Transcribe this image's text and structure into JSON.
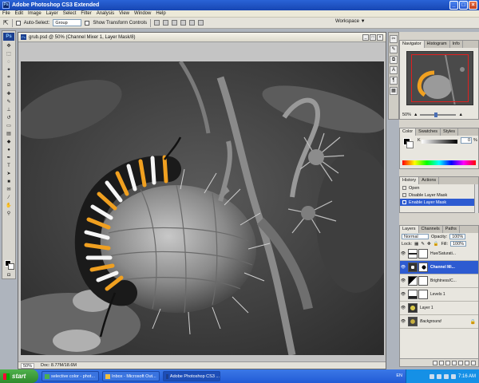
{
  "app": {
    "title": "Adobe Photoshop CS3 Extended",
    "ps_badge": "Ps",
    "window_controls": [
      "_",
      "□",
      "×"
    ]
  },
  "menu": [
    "File",
    "Edit",
    "Image",
    "Layer",
    "Select",
    "Filter",
    "Analysis",
    "View",
    "Window",
    "Help"
  ],
  "options": {
    "auto_select_label": "Auto-Select:",
    "auto_select_value": "Group",
    "show_transform_label": "Show Transform Controls",
    "workspace_label": "Workspace ▼"
  },
  "document": {
    "title": "grub.psd @ 50% (Channel Mixer 1, Layer Mask/8)",
    "zoom": "50%",
    "doc_info": "Doc: 8.77M/18.6M",
    "controls": [
      "_",
      "□",
      "×"
    ]
  },
  "navigator": {
    "tabs": [
      "Navigator",
      "Histogram",
      "Info"
    ],
    "zoom": "50%"
  },
  "color_panel": {
    "tabs": [
      "Color",
      "Swatches",
      "Styles"
    ],
    "k_label": "K",
    "k_value": "0",
    "k_unit": "%"
  },
  "history": {
    "tabs": [
      "History",
      "Actions"
    ],
    "items": [
      "Open",
      "Disable Layer Mask",
      "Enable Layer Mask"
    ],
    "selected_index": 2
  },
  "layers_panel": {
    "tabs": [
      "Layers",
      "Channels",
      "Paths"
    ],
    "blend_mode": "Normal",
    "opacity_label": "Opacity:",
    "opacity": "100%",
    "lock_label": "Lock:",
    "fill_label": "Fill:",
    "fill": "100%",
    "layers": [
      {
        "name": "Hue/Saturati...",
        "type": "adjustment",
        "selected": false
      },
      {
        "name": "Channel Mi...",
        "type": "adjustment",
        "selected": true
      },
      {
        "name": "Brightness/C...",
        "type": "adjustment",
        "selected": false
      },
      {
        "name": "Levels 1",
        "type": "adjustment",
        "selected": false
      },
      {
        "name": "Layer 1",
        "type": "pixel",
        "selected": false
      },
      {
        "name": "Background",
        "type": "background",
        "selected": false
      }
    ]
  },
  "taskbar": {
    "start": "start",
    "tasks": [
      "selective color - phot...",
      "Inbox - Microsoft Out...",
      "Adobe Photoshop CS3 ..."
    ],
    "active_task": 2,
    "language": "EN",
    "time": "7:16 AM"
  },
  "colors": {
    "xp_blue": "#225bd6",
    "selection": "#2d5bd1",
    "caterpillar_orange": "#f0a020"
  }
}
